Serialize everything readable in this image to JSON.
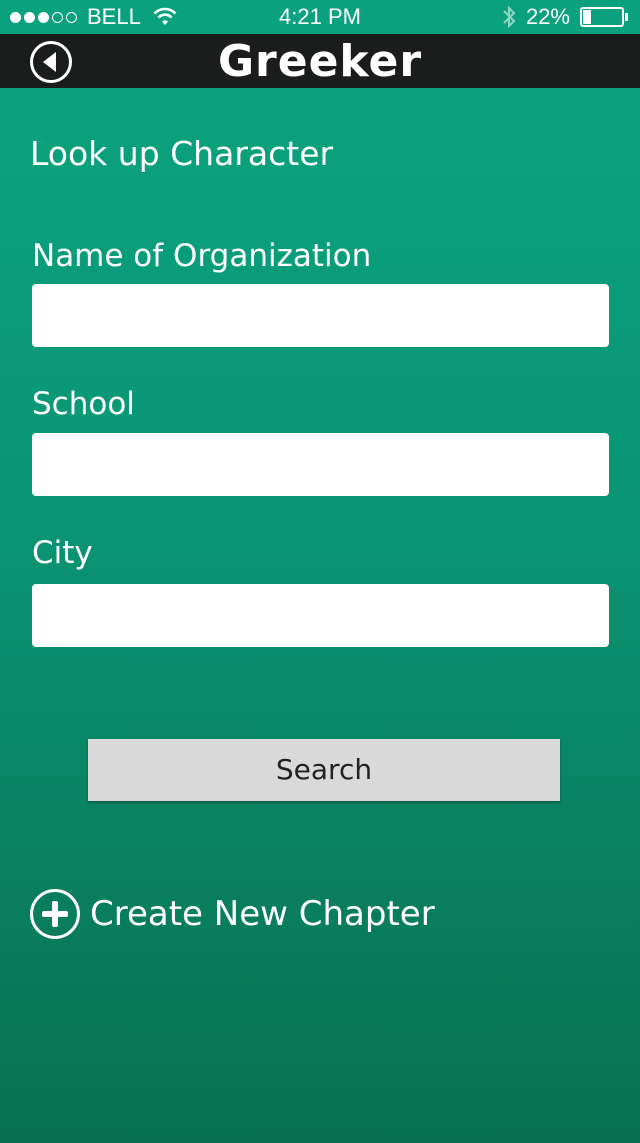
{
  "status_bar": {
    "carrier": "BELL",
    "time": "4:21 PM",
    "battery": "22%",
    "signal_dots": 5,
    "signal_filled": 3,
    "icons": [
      "wifi-icon",
      "bluetooth-icon",
      "battery-icon"
    ]
  },
  "nav": {
    "title": "Greeker",
    "back_icon": "back-arrow-circle-icon"
  },
  "form": {
    "heading": "Look up Character",
    "fields": [
      {
        "label": "Name of Organization",
        "value": "",
        "placeholder": ""
      },
      {
        "label": "School",
        "value": "",
        "placeholder": ""
      },
      {
        "label": "City",
        "value": "",
        "placeholder": ""
      }
    ],
    "search_label": "Search"
  },
  "create": {
    "label": "Create New Chapter",
    "icon": "plus-circle-icon"
  },
  "colors": {
    "background_top": "#0ba57f",
    "background_bottom": "#08704f",
    "nav_bar": "#1b1d1c",
    "button": "#d9d9d9"
  }
}
